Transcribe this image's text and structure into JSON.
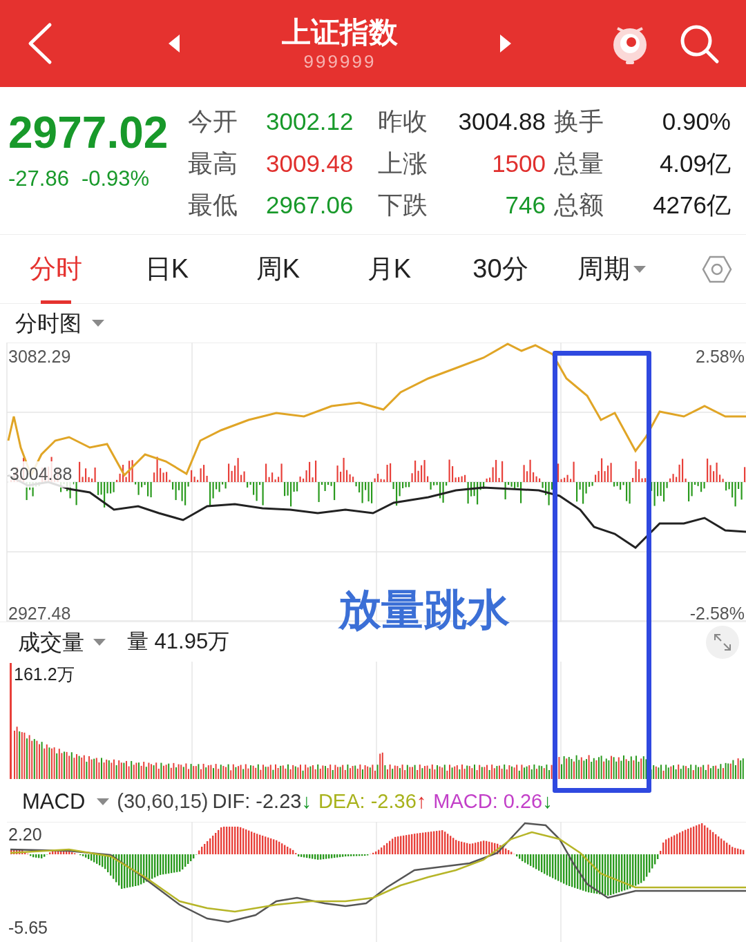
{
  "header": {
    "title": "上证指数",
    "code": "999999"
  },
  "quote": {
    "price": "2977.02",
    "change": "-27.86",
    "change_pct": "-0.93%",
    "color": "#18992a"
  },
  "stats": [
    {
      "label": "今开",
      "value": "3002.12",
      "color": "#18992a"
    },
    {
      "label": "昨收",
      "value": "3004.88",
      "color": "#1a1a1a"
    },
    {
      "label": "换手",
      "value": "0.90%",
      "color": "#1a1a1a"
    },
    {
      "label": "最高",
      "value": "3009.48",
      "color": "#e0302e"
    },
    {
      "label": "上涨",
      "value": "1500",
      "color": "#e0302e"
    },
    {
      "label": "总量",
      "value": "4.09亿",
      "color": "#1a1a1a"
    },
    {
      "label": "最低",
      "value": "2967.06",
      "color": "#18992a"
    },
    {
      "label": "下跌",
      "value": "746",
      "color": "#18992a"
    },
    {
      "label": "总额",
      "value": "4276亿",
      "color": "#1a1a1a"
    }
  ],
  "tabs": [
    {
      "label": "分时",
      "selected": true,
      "kind": "plain"
    },
    {
      "label": "日K",
      "selected": false,
      "kind": "plain"
    },
    {
      "label": "周K",
      "selected": false,
      "kind": "plain"
    },
    {
      "label": "月K",
      "selected": false,
      "kind": "plain"
    },
    {
      "label": "30分",
      "selected": false,
      "kind": "plain"
    },
    {
      "label": "周期",
      "selected": false,
      "kind": "dropdown"
    }
  ],
  "intraday": {
    "title": "分时图",
    "y_max": "3082.29",
    "y_mid": "3004.88",
    "y_min": "2927.48",
    "pct_max": "2.58%",
    "pct_min": "-2.58%",
    "annotation": "放量跳水"
  },
  "volume": {
    "title": "成交量",
    "reading": "量 41.95万",
    "y_max": "161.2万"
  },
  "macd": {
    "title": "MACD",
    "params": "(30,60,15)",
    "y_max": "2.20",
    "y_min": "-5.65",
    "indicators": [
      {
        "label": "DIF: -2.23",
        "color": "#3a3a3a",
        "arrow": {
          "symbol": "↓",
          "color": "#18992a"
        }
      },
      {
        "label": "DEA: -2.36",
        "color": "#a8b21c",
        "arrow": {
          "symbol": "↑",
          "color": "#e0302e"
        }
      },
      {
        "label": "MACD: 0.26",
        "color": "#c23fc8",
        "arrow": {
          "symbol": "↓",
          "color": "#18992a"
        }
      }
    ]
  }
}
